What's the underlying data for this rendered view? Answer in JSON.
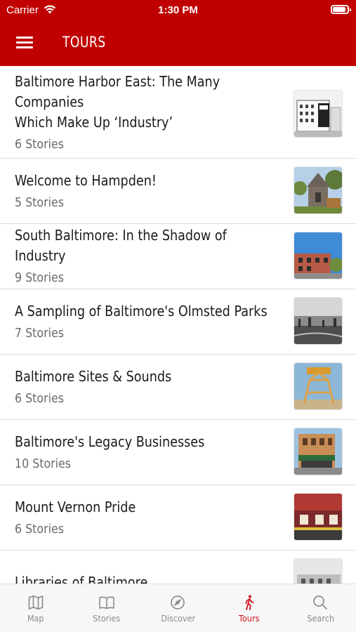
{
  "status_bar": {
    "carrier": "Carrier",
    "time": "1:30 PM",
    "battery_level": 0.9
  },
  "header": {
    "title": "TOURS",
    "menu_icon": "hamburger-menu-icon",
    "color": "#c00000"
  },
  "tours": [
    {
      "title_line1": "Baltimore Harbor East: The Many Companies",
      "title_line2": "Which Make Up ‘Industry’",
      "count": "6 Stories"
    },
    {
      "title": "Welcome to Hampden!",
      "count": "5 Stories"
    },
    {
      "title": "South Baltimore: In the Shadow of Industry",
      "count": "9 Stories"
    },
    {
      "title": "A Sampling of Baltimore's Olmsted Parks",
      "count": "7 Stories"
    },
    {
      "title": "Baltimore Sites & Sounds",
      "count": "6 Stories"
    },
    {
      "title": "Baltimore's Legacy Businesses",
      "count": "10 Stories"
    },
    {
      "title": "Mount Vernon Pride",
      "count": "6 Stories"
    },
    {
      "title": "Libraries of Baltimore",
      "count": ""
    }
  ],
  "tabbar": {
    "active_color": "#d0141b",
    "items": [
      {
        "label": "Map",
        "icon": "map-icon"
      },
      {
        "label": "Stories",
        "icon": "book-icon"
      },
      {
        "label": "Discover",
        "icon": "compass-icon"
      },
      {
        "label": "Tours",
        "icon": "walking-person-icon"
      },
      {
        "label": "Search",
        "icon": "search-icon"
      }
    ]
  }
}
